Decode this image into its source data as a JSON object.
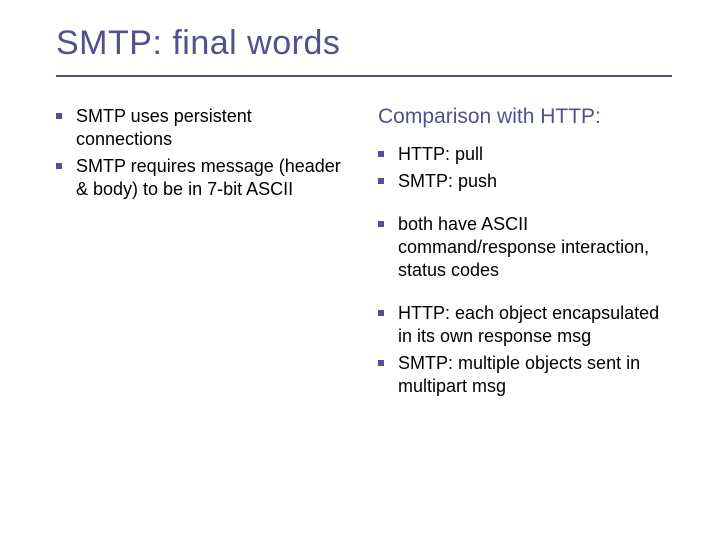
{
  "title": "SMTP: final words",
  "left": {
    "bullets": [
      "SMTP uses persistent connections",
      "SMTP requires message (header & body) to be in 7-bit ASCII"
    ]
  },
  "right": {
    "subhead": "Comparison with HTTP:",
    "group1": [
      "HTTP: pull",
      "SMTP: push"
    ],
    "group2": [
      "both have ASCII command/response interaction, status codes"
    ],
    "group3": [
      "HTTP: each object encapsulated in its own response msg",
      "SMTP: multiple objects sent in multipart msg"
    ]
  }
}
